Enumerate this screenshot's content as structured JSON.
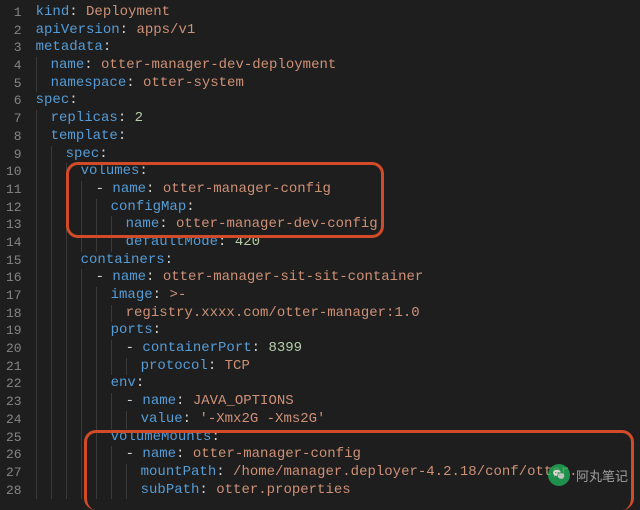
{
  "watermark": {
    "icon_label": "wechat",
    "text": "阿丸笔记"
  },
  "code": {
    "lines": [
      {
        "n": 1,
        "indent": 0,
        "tokens": [
          [
            "key",
            "kind"
          ],
          [
            "p",
            ": "
          ],
          [
            "str",
            "Deployment"
          ]
        ]
      },
      {
        "n": 2,
        "indent": 0,
        "tokens": [
          [
            "key",
            "apiVersion"
          ],
          [
            "p",
            ": "
          ],
          [
            "str",
            "apps/v1"
          ]
        ]
      },
      {
        "n": 3,
        "indent": 0,
        "tokens": [
          [
            "key",
            "metadata"
          ],
          [
            "p",
            ":"
          ]
        ]
      },
      {
        "n": 4,
        "indent": 1,
        "tokens": [
          [
            "key",
            "name"
          ],
          [
            "p",
            ": "
          ],
          [
            "str",
            "otter-manager-dev-deployment"
          ]
        ]
      },
      {
        "n": 5,
        "indent": 1,
        "tokens": [
          [
            "key",
            "namespace"
          ],
          [
            "p",
            ": "
          ],
          [
            "str",
            "otter-system"
          ]
        ]
      },
      {
        "n": 6,
        "indent": 0,
        "tokens": [
          [
            "key",
            "spec"
          ],
          [
            "p",
            ":"
          ]
        ]
      },
      {
        "n": 7,
        "indent": 1,
        "tokens": [
          [
            "key",
            "replicas"
          ],
          [
            "p",
            ": "
          ],
          [
            "num",
            "2"
          ]
        ]
      },
      {
        "n": 8,
        "indent": 1,
        "tokens": [
          [
            "key",
            "template"
          ],
          [
            "p",
            ":"
          ]
        ]
      },
      {
        "n": 9,
        "indent": 2,
        "tokens": [
          [
            "key",
            "spec"
          ],
          [
            "p",
            ":"
          ]
        ]
      },
      {
        "n": 10,
        "indent": 3,
        "tokens": [
          [
            "key",
            "volumes"
          ],
          [
            "p",
            ":"
          ]
        ]
      },
      {
        "n": 11,
        "indent": 4,
        "tokens": [
          [
            "dash",
            "- "
          ],
          [
            "key",
            "name"
          ],
          [
            "p",
            ": "
          ],
          [
            "str",
            "otter-manager-config"
          ]
        ]
      },
      {
        "n": 12,
        "indent": 5,
        "tokens": [
          [
            "key",
            "configMap"
          ],
          [
            "p",
            ":"
          ]
        ]
      },
      {
        "n": 13,
        "indent": 6,
        "tokens": [
          [
            "key",
            "name"
          ],
          [
            "p",
            ": "
          ],
          [
            "str",
            "otter-manager-dev-config"
          ]
        ]
      },
      {
        "n": 14,
        "indent": 6,
        "tokens": [
          [
            "key",
            "defaultMode"
          ],
          [
            "p",
            ": "
          ],
          [
            "num",
            "420"
          ]
        ]
      },
      {
        "n": 15,
        "indent": 3,
        "tokens": [
          [
            "key",
            "containers"
          ],
          [
            "p",
            ":"
          ]
        ]
      },
      {
        "n": 16,
        "indent": 4,
        "tokens": [
          [
            "dash",
            "- "
          ],
          [
            "key",
            "name"
          ],
          [
            "p",
            ": "
          ],
          [
            "str",
            "otter-manager-sit-sit-container"
          ]
        ]
      },
      {
        "n": 17,
        "indent": 5,
        "tokens": [
          [
            "key",
            "image"
          ],
          [
            "p",
            ": "
          ],
          [
            "str",
            ">-"
          ]
        ]
      },
      {
        "n": 18,
        "indent": 6,
        "tokens": [
          [
            "str",
            "registry.xxxx.com/otter-manager:1.0"
          ]
        ]
      },
      {
        "n": 19,
        "indent": 5,
        "tokens": [
          [
            "key",
            "ports"
          ],
          [
            "p",
            ":"
          ]
        ]
      },
      {
        "n": 20,
        "indent": 6,
        "tokens": [
          [
            "dash",
            "- "
          ],
          [
            "key",
            "containerPort"
          ],
          [
            "p",
            ": "
          ],
          [
            "num",
            "8399"
          ]
        ]
      },
      {
        "n": 21,
        "indent": 7,
        "tokens": [
          [
            "key",
            "protocol"
          ],
          [
            "p",
            ": "
          ],
          [
            "str",
            "TCP"
          ]
        ]
      },
      {
        "n": 22,
        "indent": 5,
        "tokens": [
          [
            "key",
            "env"
          ],
          [
            "p",
            ":"
          ]
        ]
      },
      {
        "n": 23,
        "indent": 6,
        "tokens": [
          [
            "dash",
            "- "
          ],
          [
            "key",
            "name"
          ],
          [
            "p",
            ": "
          ],
          [
            "str",
            "JAVA_OPTIONS"
          ]
        ]
      },
      {
        "n": 24,
        "indent": 7,
        "tokens": [
          [
            "key",
            "value"
          ],
          [
            "p",
            ": "
          ],
          [
            "str",
            "'-Xmx2G -Xms2G'"
          ]
        ]
      },
      {
        "n": 25,
        "indent": 5,
        "tokens": [
          [
            "key",
            "volumeMounts"
          ],
          [
            "p",
            ":"
          ]
        ]
      },
      {
        "n": 26,
        "indent": 6,
        "tokens": [
          [
            "dash",
            "- "
          ],
          [
            "key",
            "name"
          ],
          [
            "p",
            ": "
          ],
          [
            "str",
            "otter-manager-config"
          ]
        ]
      },
      {
        "n": 27,
        "indent": 7,
        "tokens": [
          [
            "key",
            "mountPath"
          ],
          [
            "p",
            ": "
          ],
          [
            "str",
            "/home/manager.deployer-4.2.18/conf/otter."
          ]
        ]
      },
      {
        "n": 28,
        "indent": 7,
        "tokens": [
          [
            "key",
            "subPath"
          ],
          [
            "p",
            ": "
          ],
          [
            "str",
            "otter.properties"
          ]
        ]
      }
    ]
  }
}
